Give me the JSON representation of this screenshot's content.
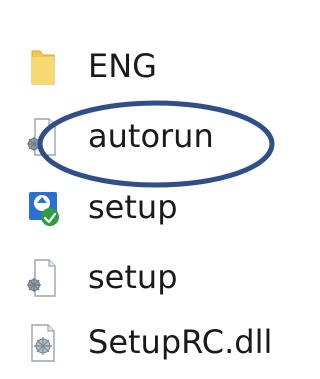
{
  "files": [
    {
      "name": "ENG",
      "icon": "folder-icon"
    },
    {
      "name": "autorun",
      "icon": "settings-file-icon"
    },
    {
      "name": "setup",
      "icon": "installer-icon"
    },
    {
      "name": "setup",
      "icon": "settings-file-icon"
    },
    {
      "name": "SetupRC.dll",
      "icon": "dll-file-icon"
    }
  ],
  "colors": {
    "folder": "#f2c94c",
    "highlight_ellipse": "#2f4f86",
    "installer_primary": "#2a6fd6",
    "installer_badge": "#2e9d43"
  }
}
